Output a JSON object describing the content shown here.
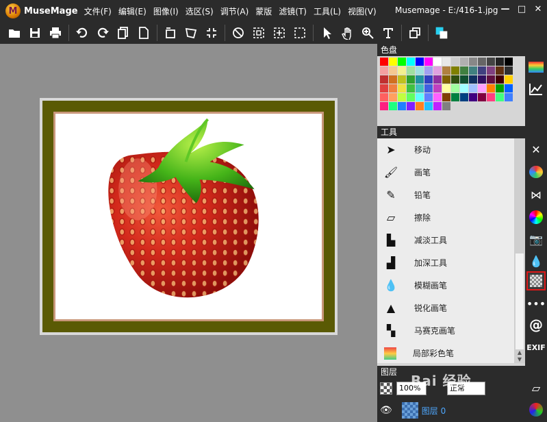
{
  "app": {
    "name": "MuseMage",
    "logo_letter": "M",
    "window_title": "Musemage - E:/416-1.jpg",
    "menu": [
      "文件(F)",
      "编辑(E)",
      "图像(I)",
      "选区(S)",
      "调节(A)",
      "蒙版",
      "滤镜(T)",
      "工具(L)",
      "视图(V)"
    ],
    "window_buttons": [
      "—",
      "□",
      "✕"
    ]
  },
  "toolbar": {
    "icons": [
      "open-icon",
      "save-icon",
      "print-icon",
      "undo-icon",
      "redo-icon",
      "copy-icon",
      "page-icon",
      "rotate-icon",
      "transform-icon",
      "fit-icon",
      "no-select-icon",
      "rect-select-icon",
      "center-select-icon",
      "marquee-icon",
      "pointer-icon",
      "hand-icon",
      "zoom-icon",
      "text-icon",
      "duplicate-icon",
      "color-picker-icon"
    ]
  },
  "panels": {
    "palette_title": "色盘",
    "tools_title": "工具",
    "layers_title": "图层"
  },
  "palette": [
    "#ff0000",
    "#ffff00",
    "#00ff00",
    "#00ffff",
    "#0000ff",
    "#ff00ff",
    "#ffffff",
    "#e8e8e8",
    "#cccccc",
    "#b0b0b0",
    "#888888",
    "#666666",
    "#444444",
    "#222222",
    "#000000",
    "#f4a0a0",
    "#f4c890",
    "#f4f090",
    "#a0e0a0",
    "#a0e0e0",
    "#a0a0f0",
    "#e0a0e0",
    "#b08040",
    "#808000",
    "#408040",
    "#408080",
    "#404080",
    "#804080",
    "#603010",
    "#303030",
    "#c03030",
    "#d07020",
    "#c0c020",
    "#30a030",
    "#2090a0",
    "#3040c0",
    "#9030a0",
    "#806000",
    "#305010",
    "#105030",
    "#103060",
    "#301060",
    "#601040",
    "#400000",
    "#ffd000",
    "#e04040",
    "#f08040",
    "#f0e040",
    "#40c040",
    "#40c0c0",
    "#4060e0",
    "#c040c0",
    "#ffffa0",
    "#a0ffa0",
    "#a0ffff",
    "#a0c0ff",
    "#ffa0ff",
    "#ff8000",
    "#00a000",
    "#0060ff",
    "#ff6060",
    "#ffa060",
    "#c0ff40",
    "#60ff60",
    "#60ffff",
    "#6080ff",
    "#ff60ff",
    "#804000",
    "#008040",
    "#004080",
    "#400080",
    "#800040",
    "#ff4080",
    "#40ff80",
    "#4080ff",
    "#ff2080",
    "#20ff80",
    "#2080ff",
    "#8020ff",
    "#ff8020",
    "#20c0ff",
    "#c020ff",
    "#808080"
  ],
  "tools": [
    {
      "icon": "move-icon",
      "label": "移动"
    },
    {
      "icon": "brush-icon",
      "label": "画笔"
    },
    {
      "icon": "pencil-icon",
      "label": "铅笔"
    },
    {
      "icon": "eraser-icon",
      "label": "擦除"
    },
    {
      "icon": "dodge-icon",
      "label": "减淡工具"
    },
    {
      "icon": "burn-icon",
      "label": "加深工具"
    },
    {
      "icon": "blur-brush-icon",
      "label": "模糊画笔"
    },
    {
      "icon": "sharpen-brush-icon",
      "label": "锐化画笔"
    },
    {
      "icon": "mosaic-brush-icon",
      "label": "马赛克画笔"
    },
    {
      "icon": "local-color-brush-icon",
      "label": "局部彩色笔"
    }
  ],
  "layers": {
    "opacity": "100%",
    "blend_mode": "正常",
    "layer_name": "图层 0"
  },
  "side_icons": [
    "palette-panel-icon",
    "histogram-icon",
    "tools-panel-icon",
    "color-palette-icon",
    "butterfly-icon",
    "color-wheel-icon",
    "camera-icon",
    "drops-icon",
    "pattern-icon",
    "more-icon",
    "at-icon",
    "exif-icon",
    "eraser-panel-icon",
    "rgb-icon"
  ],
  "side_labels": {
    "exif": "EXIF",
    "at": "@",
    "more": "•••"
  },
  "watermark": "Bai 经验"
}
